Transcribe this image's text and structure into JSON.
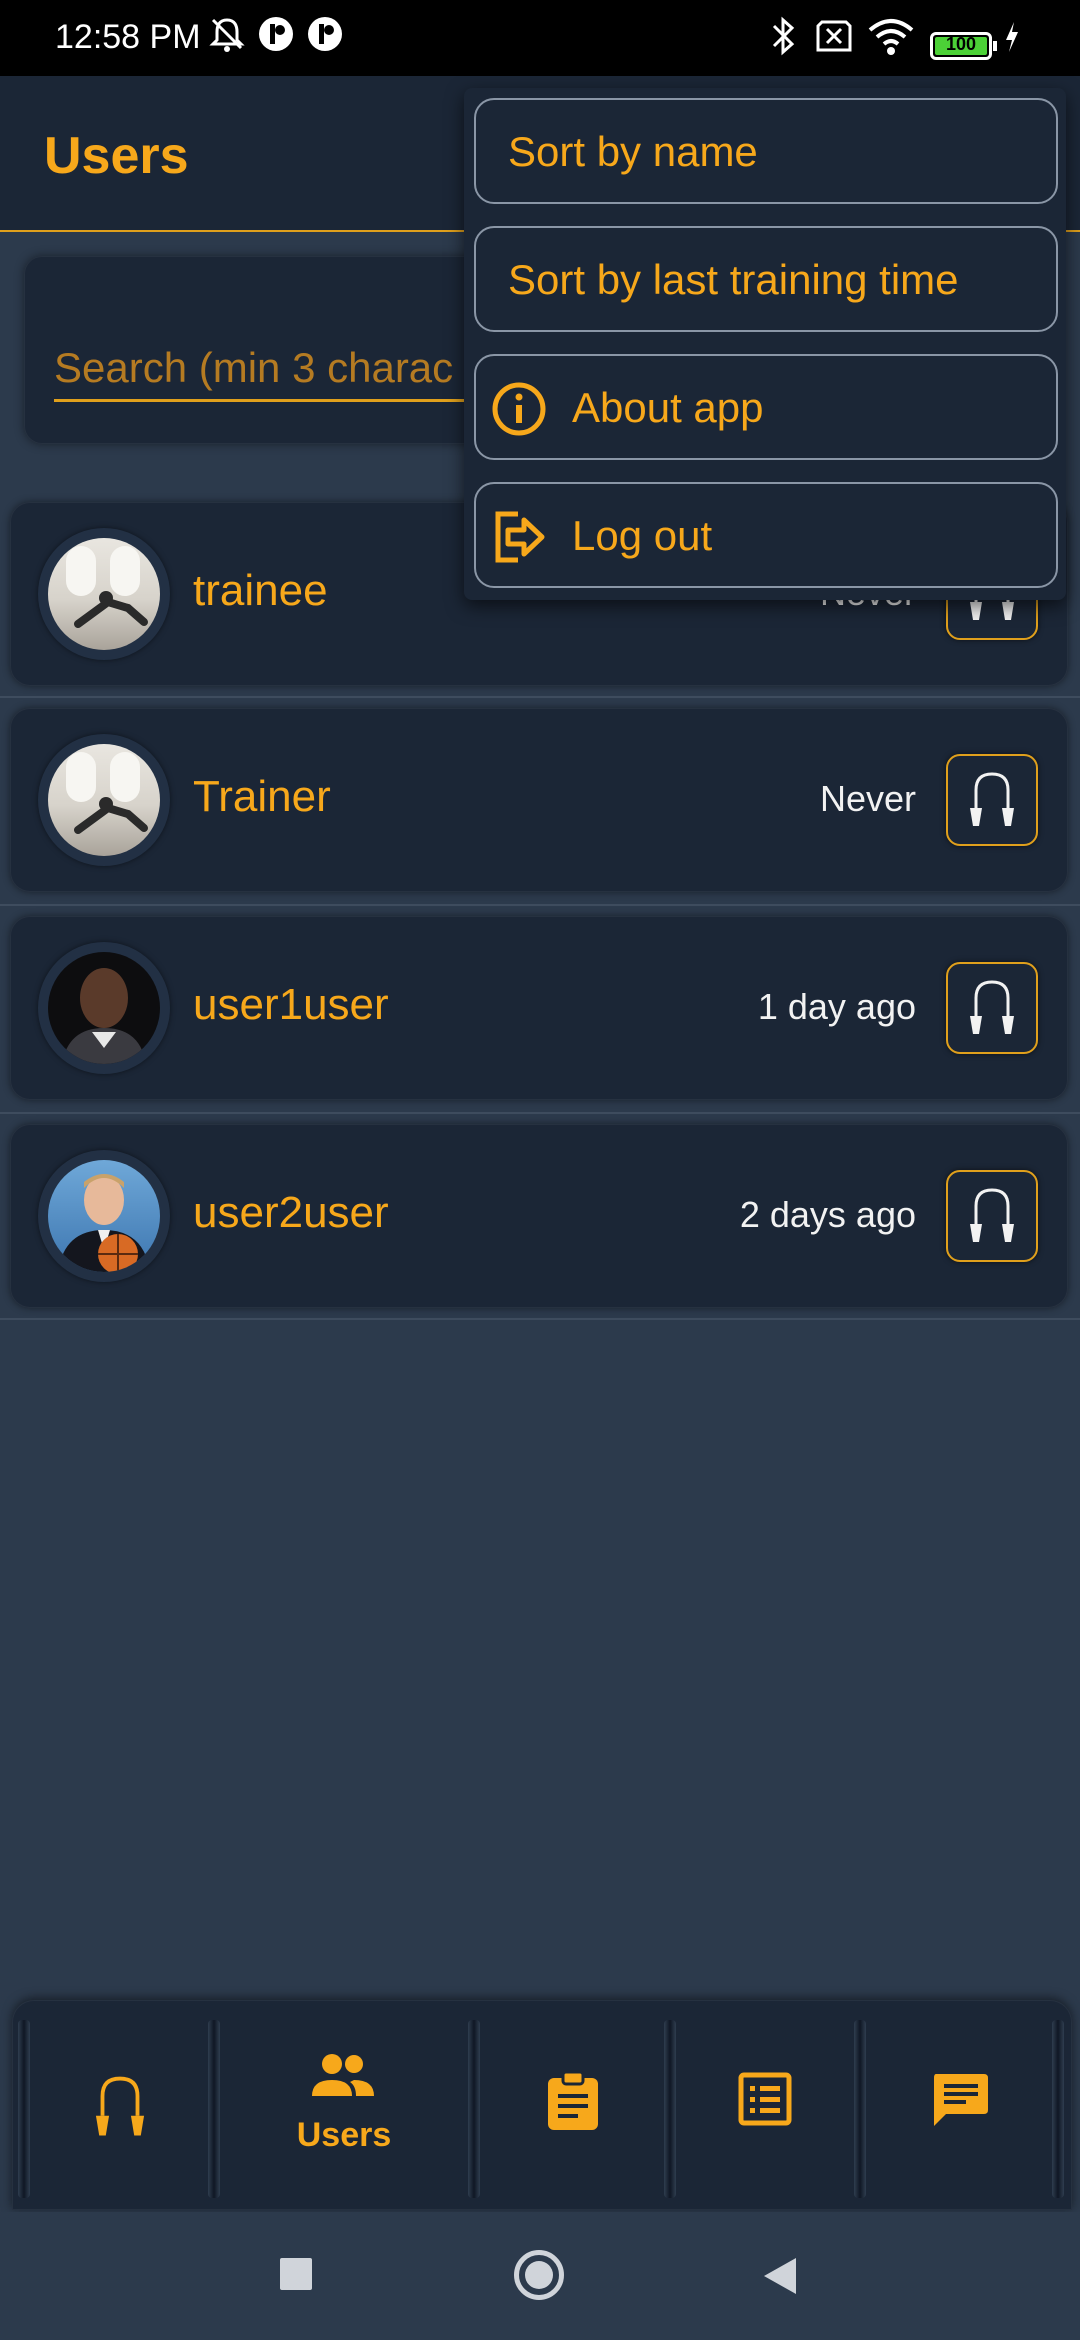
{
  "status_bar": {
    "time": "12:58 PM",
    "battery": "100"
  },
  "app_bar": {
    "title": "Users"
  },
  "search": {
    "placeholder": "Search (min 3 charac"
  },
  "users": [
    {
      "name": "trainee",
      "last_training": "Never"
    },
    {
      "name": "Trainer",
      "last_training": "Never"
    },
    {
      "name": "user1user",
      "last_training": "1 day ago"
    },
    {
      "name": "user2user",
      "last_training": "2 days ago"
    }
  ],
  "menu": {
    "items": [
      {
        "label": "Sort by name",
        "icon": ""
      },
      {
        "label": "Sort by last training time",
        "icon": ""
      },
      {
        "label": "About app",
        "icon": "info-icon"
      },
      {
        "label": "Log out",
        "icon": "logout-icon"
      }
    ]
  },
  "bottom_nav": {
    "items": [
      {
        "label": "",
        "icon": "jump-rope-icon"
      },
      {
        "label": "Users",
        "icon": "users-icon"
      },
      {
        "label": "",
        "icon": "clipboard-icon"
      },
      {
        "label": "",
        "icon": "list-icon"
      },
      {
        "label": "",
        "icon": "chat-icon"
      }
    ]
  },
  "colors": {
    "accent": "#f7a81b",
    "background": "#2c3a4c",
    "surface": "#1b2636"
  }
}
